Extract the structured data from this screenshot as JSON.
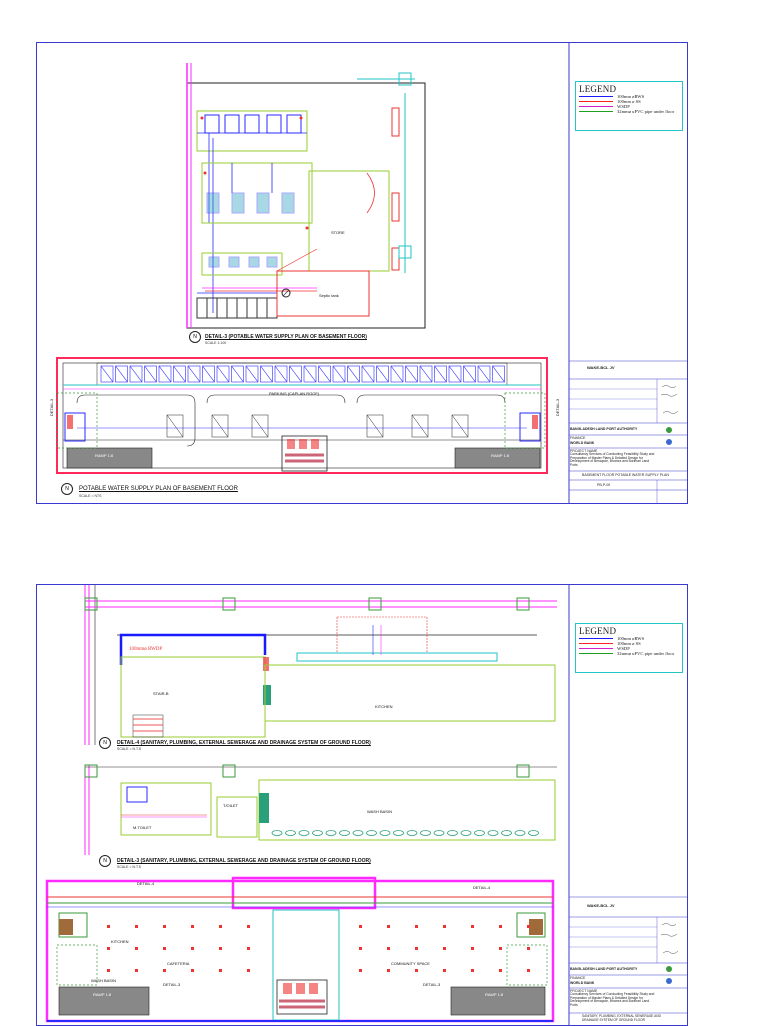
{
  "sheet1": {
    "legend": {
      "title": "LEGEND",
      "items": [
        {
          "label": "100mm øRWS",
          "color": "#1a1aff"
        },
        {
          "label": "100mm ø SS",
          "color": "#ff2020"
        },
        {
          "label": "WSDP",
          "color": "#d020d0"
        },
        {
          "label": "32mmø uPVC pipe under floor",
          "color": "#20a020"
        }
      ]
    },
    "detail_title": "DETAIL-3 (POTABLE WATER SUPPLY PLAN OF BASEMENT FLOOR)",
    "detail_scale": "SCALE 1:100",
    "main_title": "POTABLE WATER SUPPLY PLAN OF BASEMENT FLOOR",
    "main_scale": "SCALE = NTS",
    "labels": {
      "store": "STORE",
      "septic": "Septic tank",
      "parking": "PARKING (CAPLAN ROOF)",
      "ramp_left": "RAMP 1:8",
      "ramp_right": "RAMP 1:8",
      "detail_left": "DETAIL-3",
      "detail_right": "DETAIL-3"
    },
    "title_block": {
      "firm": "WAKE-BCL JV",
      "client": "BANGLADESH LAND PORT AUTHORITY",
      "funder_label": "FINANCE",
      "funder": "WORLD BANK",
      "project_label": "PROJECT NAME",
      "project": "Consultancy Services of Conducting Feasibility Study and Preparation of Master Plans & Detailed Design for Development of Benapole, Bhomra and Burimari Land Ports",
      "drawing": "BASEMENT FLOOR POTABLE WATER SUPPLY PLAN",
      "sheet_no": "PB-P-00"
    }
  },
  "sheet2": {
    "legend": {
      "title": "LEGEND",
      "items": [
        {
          "label": "100mm øRWS",
          "color": "#1a1aff"
        },
        {
          "label": "100mm ø SS",
          "color": "#ff2020"
        },
        {
          "label": "WSDP",
          "color": "#d020d0"
        },
        {
          "label": "32mmø uPVC pipe under floor",
          "color": "#20a020"
        }
      ]
    },
    "detail4_title": "DETAIL-4 (SANITARY, PLUMBING, EXTERNAL SEWERAGE AND DRAINAGE SYSTEM OF GROUND FLOOR)",
    "detail4_scale": "SCALE = N.T.S",
    "detail3_title": "DETAIL-3 (SANITARY, PLUMBING, EXTERNAL SEWERAGE AND DRAINAGE SYSTEM OF GROUND FLOOR)",
    "detail3_scale": "SCALE = N.T.S",
    "labels": {
      "rwdp": "100mmø RWDP",
      "stair": "STAIR-B",
      "kitchen": "KITCHEN",
      "toilet": "T/OILET",
      "mtoilet": "M.TOILET",
      "wash_basin": "WASH BASIN",
      "kitchen2": "KITCHEN",
      "cafeteria": "CAFETERIA",
      "community": "COMMUNITY SPACE",
      "wash_basin2": "WASH BASIN",
      "ramp_left": "RAMP 1:8",
      "ramp_right": "RAMP 1:8",
      "detail4_tag_left": "DETAIL-4",
      "detail4_tag_right": "DETAIL-4",
      "detail3_tag_left": "DETAIL-3",
      "detail3_tag_right": "DETAIL-3"
    },
    "title_block": {
      "firm": "WAKE-BCL JV",
      "client": "BANGLADESH LAND PORT AUTHORITY",
      "funder_label": "FINANCE",
      "funder": "WORLD BANK",
      "project_label": "PROJECT NAME",
      "project": "Consultancy Services of Conducting Feasibility Study and Preparation of Master Plans & Detailed Design for Development of Benapole, Bhomra and Burimari Land Ports",
      "drawing": "SANITARY, PLUMBING, EXTERNAL SEWERAGE AND DRAINAGE SYSTEM OF GROUND FLOOR"
    }
  }
}
